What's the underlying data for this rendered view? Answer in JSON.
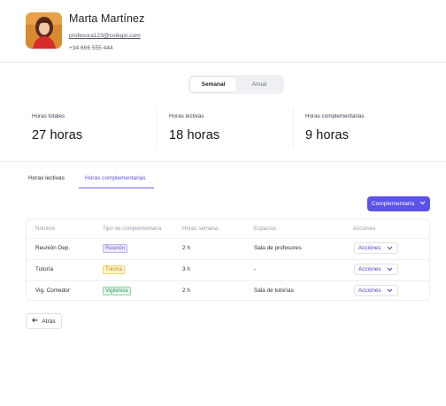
{
  "profile": {
    "name": "Marta Martínez",
    "email": "profesora123@colegio.com",
    "phone": "+34 666 555 444"
  },
  "view_toggle": {
    "options": [
      "Semanal",
      "Anual"
    ],
    "selected": "Semanal"
  },
  "stats": [
    {
      "label": "Horas totales",
      "value": "27 horas"
    },
    {
      "label": "Horas lectivas",
      "value": "18 horas"
    },
    {
      "label": "Horas complementarias",
      "value": "9 horas"
    }
  ],
  "tabs": [
    {
      "label": "Horas lectivas",
      "active": false
    },
    {
      "label": "Horas complementarias",
      "active": true
    }
  ],
  "add_button": {
    "label": "Complementaria",
    "icon": "chevron-down-icon"
  },
  "table": {
    "headers": [
      "Nombre",
      "Tipo de complementaria",
      "Horas semana",
      "Espacios",
      "Acciones"
    ],
    "rows": [
      {
        "name": "Reunión Dep.",
        "type": "Reunión",
        "hours": "2 h",
        "space": "Sala de profesores",
        "action": "Acciones"
      },
      {
        "name": "Tutoría",
        "type": "Tutoría",
        "hours": "3 h",
        "space": "-",
        "action": "Acciones"
      },
      {
        "name": "Vig. Comedor",
        "type": "Vigilancia",
        "hours": "2 h",
        "space": "Sala de tutorías",
        "action": "Acciones"
      }
    ]
  },
  "back_button": {
    "label": "Atrás",
    "icon": "arrow-left-icon"
  },
  "colors": {
    "accent": "#5b52e8",
    "badge_reunion": "#6a61d9",
    "badge_tutoria": "#c48a10",
    "badge_vigilancia": "#2a9a55"
  }
}
